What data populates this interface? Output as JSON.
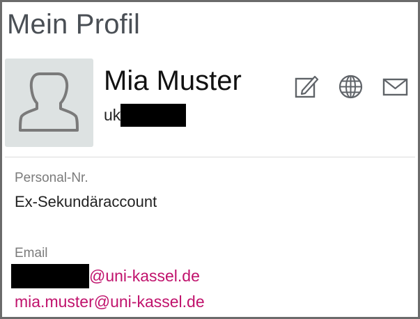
{
  "page": {
    "title": "Mein Profil"
  },
  "profile": {
    "name": "Mia Muster",
    "username_prefix": "uk",
    "avatar_icon": "user-silhouette-icon"
  },
  "actions": {
    "edit_icon": "edit-icon",
    "web_icon": "globe-icon",
    "mail_icon": "mail-icon"
  },
  "fields": {
    "personal_nr_label": "Personal-Nr.",
    "personal_nr_value": "Ex-Sekundäraccount",
    "email_label": "Email",
    "emails": [
      {
        "suffix": "@uni-kassel.de"
      },
      {
        "address": "mia.muster@uni-kassel.de"
      }
    ]
  },
  "colors": {
    "link": "#c0126c",
    "avatar_bg": "#dde2e2",
    "icon": "#5f6368",
    "title": "#4a4f55"
  }
}
